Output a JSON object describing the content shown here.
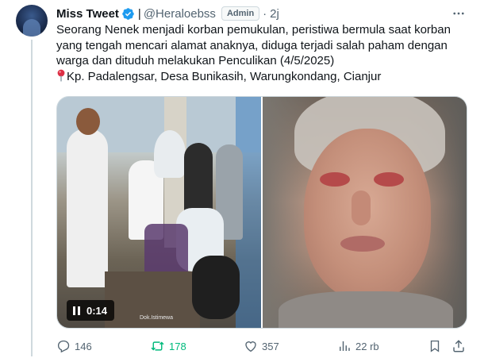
{
  "author": {
    "name": "Miss Tweet",
    "separator": "|",
    "handle": "@Heraloebss",
    "badge": "Admin",
    "dot": "·",
    "time": "2j"
  },
  "tweet": {
    "lines": [
      "Seorang Nenek menjadi korban pemukulan, peristiwa bermula saat korban",
      "yang tengah mencari alamat anaknya, diduga terjadi salah paham dengan",
      "warga dan dituduh melakukan Penculikan (4/5/2025)"
    ],
    "location": "Kp. Padalengsar, Desa Bunikasih, Warungkondang, Cianjur"
  },
  "media": {
    "video_time": "0:14",
    "watermark": "Dok.Istimewa"
  },
  "actions": {
    "replies": "146",
    "retweets": "178",
    "likes": "357",
    "views": "22 rb"
  },
  "colors": {
    "verified": "#1d9bf0",
    "retweet_active": "#00ba7c",
    "secondary_text": "#536471"
  }
}
